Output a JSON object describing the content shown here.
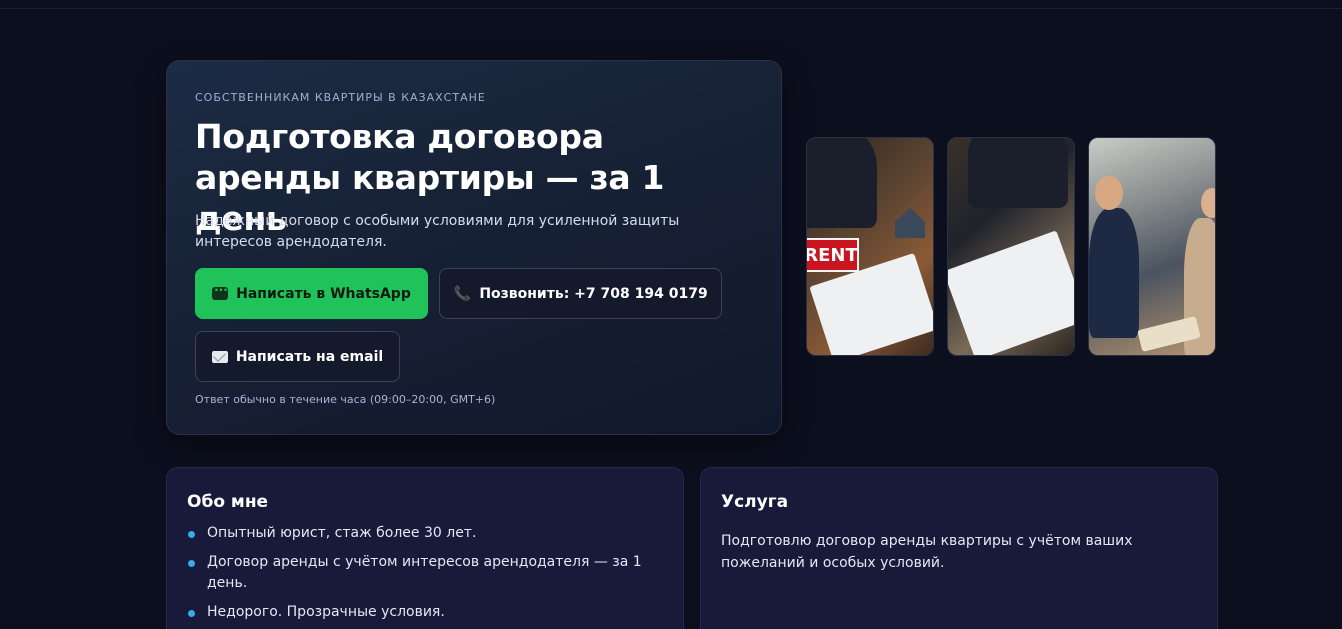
{
  "hero": {
    "eyebrow": "СОБСТВЕННИКАМ КВАРТИРЫ В КАЗАХСТАНЕ",
    "title": "Подготовка договора аренды квартиры — за 1 день",
    "subtitle": "Надёжный договор с особыми условиями для усиленной защиты интересов арендодателя.",
    "buttons": {
      "whatsapp": "Написать в WhatsApp",
      "call": "Позвонить: +7 708 194 0179",
      "email": "Написать на email"
    },
    "note": "Ответ обычно в течение часа (09:00–20:00, GMT+6)"
  },
  "photos": {
    "rent_sign": "RENT"
  },
  "about": {
    "title": "Обо мне",
    "items": [
      "Опытный юрист, стаж более 30 лет.",
      "Договор аренды с учётом интересов арендодателя — за 1 день.",
      "Недорого. Прозрачные условия."
    ]
  },
  "service": {
    "title": "Услуга",
    "text": "Подготовлю договор аренды квартиры с учётом ваших пожеланий и особых условий."
  },
  "colors": {
    "background": "#0c0f1e",
    "whatsapp": "#20c35a",
    "bullet": "#3aa9f0",
    "card": "#171a38"
  }
}
